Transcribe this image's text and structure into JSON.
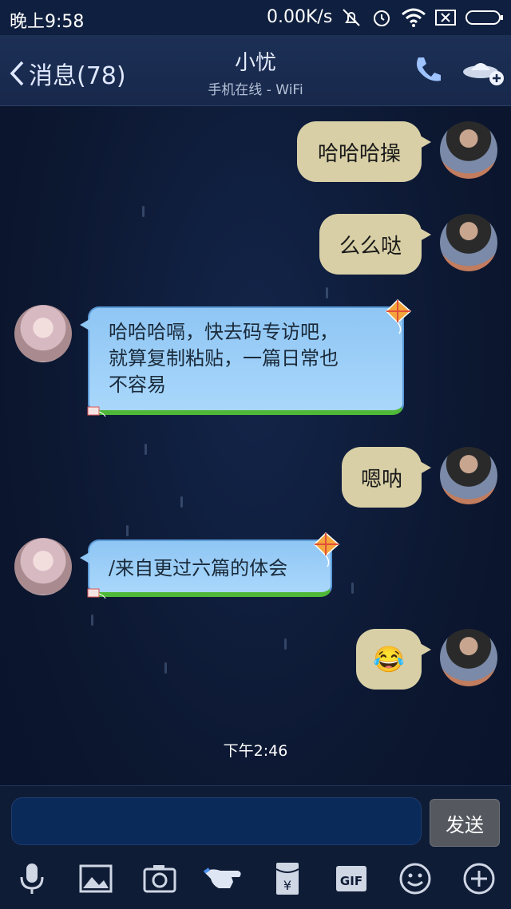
{
  "status_bar": {
    "time": "晚上9:58",
    "network_speed": "0.00K/s",
    "icons": [
      "mute-icon",
      "alarm-icon",
      "wifi-icon",
      "sim-off-icon",
      "battery-icon"
    ]
  },
  "header": {
    "back_label": "消息(78)",
    "contact_name": "小忧",
    "contact_status": "手机在线 - WiFi",
    "icons": [
      "phone-icon",
      "ufo-add-icon"
    ]
  },
  "messages": [
    {
      "from": "me",
      "text": "哈哈哈操"
    },
    {
      "from": "me",
      "text": "么么哒"
    },
    {
      "from": "her",
      "lines": [
        "哈哈哈嗝，快去码专访吧，",
        "就算复制粘贴，一篇日常也",
        "不容易"
      ]
    },
    {
      "from": "me",
      "text": "嗯呐"
    },
    {
      "from": "her",
      "lines": [
        "/来自更过六篇的体会"
      ]
    },
    {
      "from": "me",
      "text": "😂"
    }
  ],
  "timestamp": "下午2:46",
  "input": {
    "placeholder": "",
    "send_label": "发送"
  },
  "toolbar": [
    "microphone-icon",
    "image-icon",
    "camera-icon",
    "pointer-icon",
    "red-packet-icon",
    "gif-icon",
    "emoji-icon",
    "plus-icon"
  ],
  "colors": {
    "my_bubble": "#d8cfa6",
    "her_bubble": "#8fc6f4",
    "background": "#0e1a33"
  }
}
